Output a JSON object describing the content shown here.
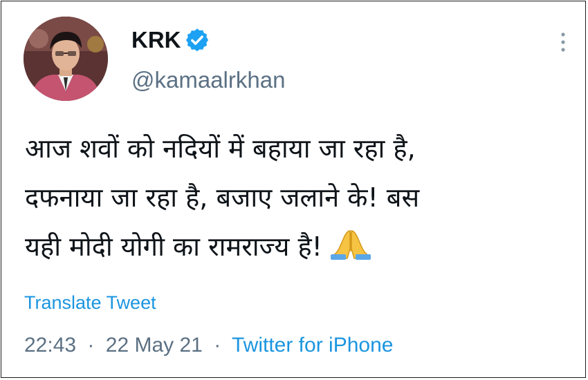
{
  "author": {
    "display_name": "KRK",
    "handle": "@kamaalrkhan",
    "verified_icon": "verified-badge-icon",
    "avatar_icon": "profile-photo"
  },
  "more_icon": "more-vertical-icon",
  "tweet": {
    "lines": [
      "आज शवों को नदियों में बहाया जा रहा है,",
      "दफनाया जा रहा है, बजाए जलाने के! बस",
      "यही मोदी योगी का रामराज्य है!"
    ],
    "emoji_icon": "folded-hands-icon"
  },
  "translate_label": "Translate Tweet",
  "meta": {
    "time": "22:43",
    "separator_1": "·",
    "date": "22 May 21",
    "separator_2": "·",
    "source": "Twitter for iPhone"
  },
  "colors": {
    "link": "#1b95e0",
    "secondary_text": "#5b7083",
    "primary_text": "#0f1419",
    "verified": "#1da1f2"
  }
}
